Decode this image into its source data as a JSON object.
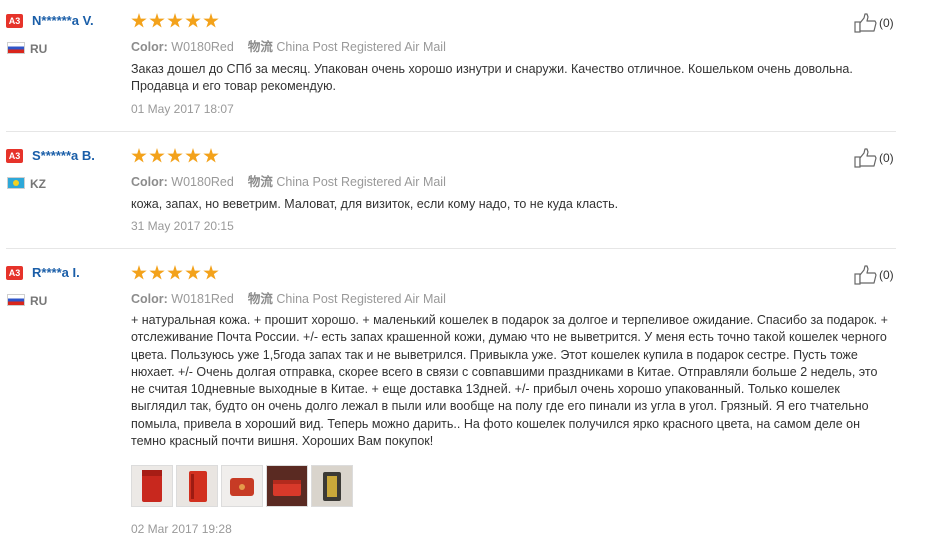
{
  "reviews": [
    {
      "level_badge": "A3",
      "name": "N******a V.",
      "country": "RU",
      "flag": "flag-ru",
      "stars": 5,
      "color_label": "Color:",
      "color_value": "W0180Red",
      "shipping_label": "物流",
      "shipping_value": "China Post Registered Air Mail",
      "text": "Заказ дошел до СПб за месяц. Упакован очень хорошо изнутри и снаружи. Качество отличное. Кошельком очень довольна. Продавца и его товар рекомендую.",
      "date": "01 May 2017 18:07",
      "helpful_count": "(0)"
    },
    {
      "level_badge": "A3",
      "name": "S******a B.",
      "country": "KZ",
      "flag": "flag-kz",
      "stars": 5,
      "color_label": "Color:",
      "color_value": "W0180Red",
      "shipping_label": "物流",
      "shipping_value": "China Post Registered Air Mail",
      "text": "кожа, запах, но веветрим. Маловат, для визиток, если кому надо, то не куда класть.",
      "date": "31 May 2017 20:15",
      "helpful_count": "(0)"
    },
    {
      "level_badge": "A3",
      "name": "R****a I.",
      "country": "RU",
      "flag": "flag-ru",
      "stars": 5,
      "color_label": "Color:",
      "color_value": "W0181Red",
      "shipping_label": "物流",
      "shipping_value": "China Post Registered Air Mail",
      "text": "+ натуральная кожа. + прошит хорошо. + маленький кошелек в подарок за долгое и терпеливое ожидание. Спасибо за подарок. + отслеживание Почта России. +/- есть запах крашенной кожи, думаю что не выветрится. У меня есть точно такой кошелек черного цвета. Пользуюсь уже 1,5года запах так и не выветрился. Привыкла уже. Этот кошелек купила в подарок сестре. Пусть тоже нюхает. +/- Очень долгая отправка, скорее всего в связи с совпавшими праздниками в Китае. Отправляли больше 2 недель, это не считая 10дневные выходные в Китае. + еще доставка 13дней. +/- прибыл очень хорошо упакованный. Только кошелек выглядил так, будто он очень долго лежал в пыли или вообще на полу где его пинали из угла в угол. Грязный. Я его тчательно помыла, привела в хороший вид. Теперь можно дарить.. На фото кошелек получился ярко красного цвета, на самом деле он темно красный почти вишня. Хороших Вам покупок!",
      "date": "02 Mar 2017 19:28",
      "helpful_count": "(0)",
      "photos": [
        "red-wallet-photo",
        "red-wallet-photo",
        "red-wallet-photo",
        "red-wallet-photo",
        "wallet-box-photo"
      ]
    }
  ],
  "colors": {
    "name": "#1a5ea8",
    "star": "#f3a21b",
    "badge": "#e6332a"
  }
}
